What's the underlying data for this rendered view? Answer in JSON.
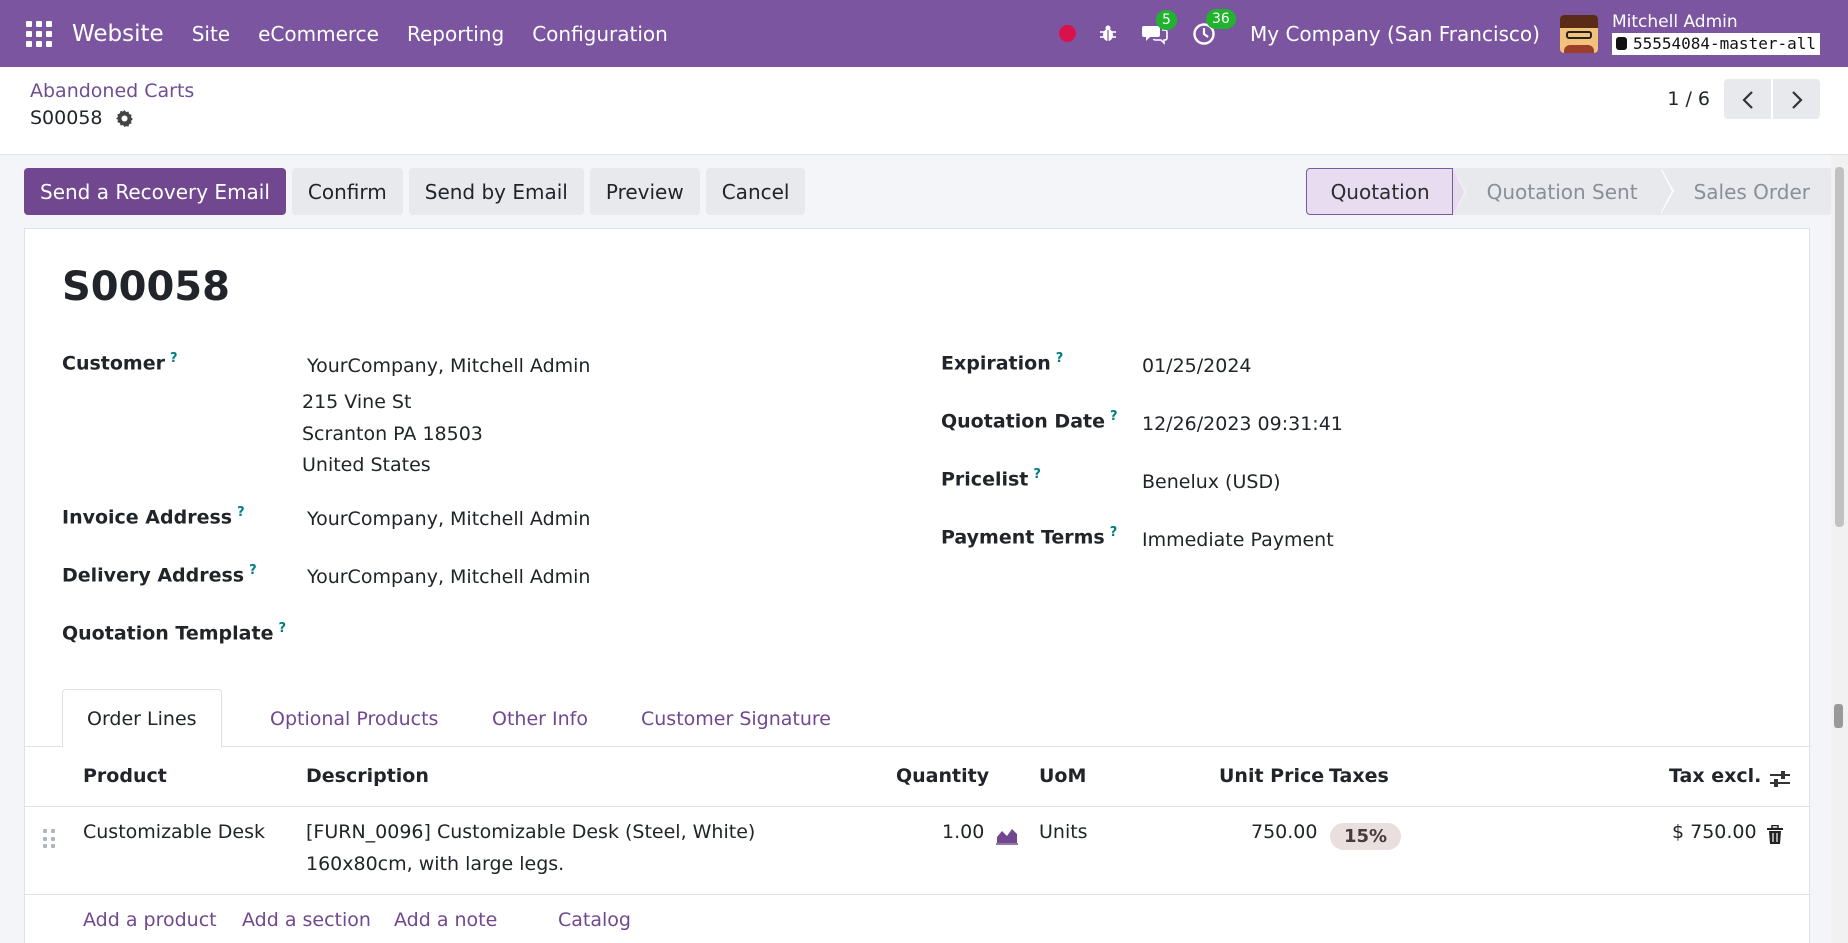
{
  "navbar": {
    "app_name": "Website",
    "menu": [
      "Site",
      "eCommerce",
      "Reporting",
      "Configuration"
    ],
    "messages_count": "5",
    "activities_count": "36",
    "company": "My Company (San Francisco)",
    "user_name": "Mitchell Admin",
    "database": "55554084-master-all"
  },
  "breadcrumb": {
    "parent": "Abandoned Carts",
    "current": "S00058"
  },
  "pager": {
    "value": "1 / 6"
  },
  "actions": {
    "recovery_email": "Send a Recovery Email",
    "confirm": "Confirm",
    "send_by_email": "Send by Email",
    "preview": "Preview",
    "cancel": "Cancel"
  },
  "stages": [
    "Quotation",
    "Quotation Sent",
    "Sales Order"
  ],
  "form": {
    "name": "S00058",
    "customer_label": "Customer",
    "customer_name": "YourCompany, Mitchell Admin",
    "customer_street": "215 Vine St",
    "customer_city": "Scranton PA 18503",
    "customer_country": "United States",
    "invoice_label": "Invoice Address",
    "invoice_value": "YourCompany, Mitchell Admin",
    "delivery_label": "Delivery Address",
    "delivery_value": "YourCompany, Mitchell Admin",
    "template_label": "Quotation Template",
    "expiration_label": "Expiration",
    "expiration_value": "01/25/2024",
    "quotation_date_label": "Quotation Date",
    "quotation_date_value": "12/26/2023 09:31:41",
    "pricelist_label": "Pricelist",
    "pricelist_value": "Benelux (USD)",
    "payment_terms_label": "Payment Terms",
    "payment_terms_value": "Immediate Payment",
    "help_mark": "?"
  },
  "tabs": [
    "Order Lines",
    "Optional Products",
    "Other Info",
    "Customer Signature"
  ],
  "table": {
    "headers": {
      "product": "Product",
      "description": "Description",
      "quantity": "Quantity",
      "uom": "UoM",
      "unit_price": "Unit Price",
      "taxes": "Taxes",
      "tax_excl": "Tax excl."
    },
    "rows": [
      {
        "product": "Customizable Desk",
        "description_line1": "[FURN_0096] Customizable Desk (Steel, White)",
        "description_line2": "160x80cm, with large legs.",
        "quantity": "1.00",
        "uom": "Units",
        "unit_price": "750.00",
        "tax": "15%",
        "subtotal": "$ 750.00"
      }
    ],
    "add_links": [
      "Add a product",
      "Add a section",
      "Add a note",
      "Catalog"
    ]
  },
  "colors": {
    "navbar": "#7c55a0",
    "primary": "#71488f",
    "badge": "#21b22e",
    "record_dot": "#d9124b"
  }
}
